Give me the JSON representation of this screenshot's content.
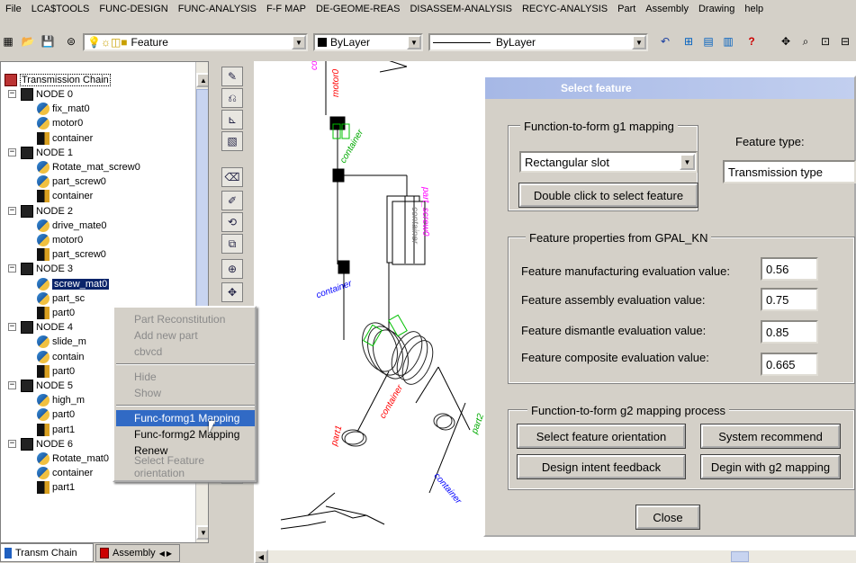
{
  "menu": [
    "File",
    "LCA$TOOLS",
    "FUNC-DESIGN",
    "FUNC-ANALYSIS",
    "F-F MAP",
    "DE-GEOME-REAS",
    "DISASSEM-ANALYSIS",
    "RECYC-ANALYSIS",
    "Part",
    "Assembly",
    "Drawing",
    "help"
  ],
  "toolbar": {
    "layer_combo": "Feature",
    "color_combo": "ByLayer",
    "linetype_combo": "ByLayer"
  },
  "tree": {
    "root": "Transmission Chain",
    "rows": [
      {
        "label": "NODE 0",
        "icon": "node"
      },
      {
        "label": "fix_mat0",
        "icon": "part"
      },
      {
        "label": "motor0",
        "icon": "part"
      },
      {
        "label": "container",
        "icon": "container"
      },
      {
        "label": "NODE 1",
        "icon": "node"
      },
      {
        "label": "Rotate_mat_screw0",
        "icon": "part"
      },
      {
        "label": "part_screw0",
        "icon": "part"
      },
      {
        "label": "container",
        "icon": "container"
      },
      {
        "label": "NODE 2",
        "icon": "node"
      },
      {
        "label": "drive_mate0",
        "icon": "part"
      },
      {
        "label": "motor0",
        "icon": "part"
      },
      {
        "label": "part_screw0",
        "icon": "container"
      },
      {
        "label": "NODE 3",
        "icon": "node"
      },
      {
        "label": "screw_mat0",
        "icon": "part"
      },
      {
        "label": "part_sc",
        "icon": "part"
      },
      {
        "label": "part0",
        "icon": "container"
      },
      {
        "label": "NODE 4",
        "icon": "node"
      },
      {
        "label": "slide_m",
        "icon": "part"
      },
      {
        "label": "contain",
        "icon": "part"
      },
      {
        "label": "part0",
        "icon": "container"
      },
      {
        "label": "NODE 5",
        "icon": "node"
      },
      {
        "label": "high_m",
        "icon": "part"
      },
      {
        "label": "part0",
        "icon": "part"
      },
      {
        "label": "part1",
        "icon": "container"
      },
      {
        "label": "NODE 6",
        "icon": "node"
      },
      {
        "label": "Rotate_mat0",
        "icon": "part"
      },
      {
        "label": "container",
        "icon": "part"
      },
      {
        "label": "part1",
        "icon": "container"
      }
    ],
    "tabs": [
      "Transm Chain",
      "Assembly"
    ]
  },
  "context_menu": [
    {
      "label": "Part Reconstitution",
      "disabled": true
    },
    {
      "label": "Add new part",
      "disabled": true
    },
    {
      "label": "cbvcd",
      "disabled": true
    },
    {
      "sep": true
    },
    {
      "label": "Hide",
      "disabled": true
    },
    {
      "label": "Show",
      "disabled": true
    },
    {
      "sep": true
    },
    {
      "label": "Func-formg1 Mapping",
      "highlighted": true
    },
    {
      "label": "Func-formg2 Mapping"
    },
    {
      "label": "Renew"
    },
    {
      "label": "Select Feature orientation",
      "disabled": true
    }
  ],
  "dialog": {
    "title": "Select feature",
    "g1_group": {
      "title": "Function-to-form g1 mapping",
      "selected": "Rectangular slot",
      "button": "Double click to select feature"
    },
    "feature_type": {
      "label": "Feature type:",
      "value": "Transmission type"
    },
    "props_group": {
      "title": "Feature properties from GPAL_KN",
      "rows": [
        {
          "label": "Feature manufacturing evaluation value:",
          "value": "0.56"
        },
        {
          "label": "Feature assembly evaluation value:",
          "value": "0.75"
        },
        {
          "label": "Feature dismantle evaluation value:",
          "value": "0.85"
        },
        {
          "label": "Feature composite evaluation value:",
          "value": "0.665"
        }
      ]
    },
    "g2_group": {
      "title": "Function-to-form g2 mapping process",
      "buttons": [
        "Select feature orientation",
        "System recommend",
        "Design intent feedback",
        "Degin with g2 mapping"
      ]
    },
    "close": "Close"
  },
  "canvas_labels": [
    {
      "text": "container",
      "color": "#ff00ff"
    },
    {
      "text": "motor0",
      "color": "#ff0000"
    },
    {
      "text": "container",
      "color": "#00aa00"
    },
    {
      "text": "part_screw0",
      "color": "#ff00ff"
    },
    {
      "text": "container",
      "color": "#808080"
    },
    {
      "text": "container",
      "color": "#0000ff"
    },
    {
      "text": "part1",
      "color": "#ff0000"
    },
    {
      "text": "container",
      "color": "#ff0000"
    },
    {
      "text": "part2",
      "color": "#00aa00"
    },
    {
      "text": "container",
      "color": "#0000ff"
    }
  ]
}
